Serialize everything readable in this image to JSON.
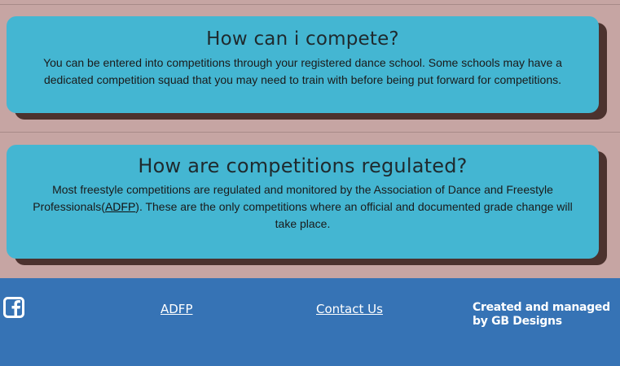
{
  "sections": [
    {
      "title": "How can i compete?",
      "body": "You can be entered into competitions through your registered dance school. Some schools may have a dedicated competition squad that you may need to train with before being put forward for competitions."
    },
    {
      "title": "How are competitions regulated?",
      "body_before": "Most freestyle competitions are regulated and monitored by the Association of Dance and Freestyle Professionals(",
      "body_link": "ADFP",
      "body_after": "). These are the only competitions where an official and documented grade change will take place."
    }
  ],
  "footer": {
    "icon": "facebook-icon",
    "links": [
      "ADFP",
      "Contact Us"
    ],
    "credit_prefix": "Created and managed by ",
    "credit_name": "GB Designs"
  },
  "colors": {
    "page_bg": "#c6a5a3",
    "card_bg": "#44b6d2",
    "card_shadow": "#4c322e",
    "footer_bg": "#3673b5"
  }
}
